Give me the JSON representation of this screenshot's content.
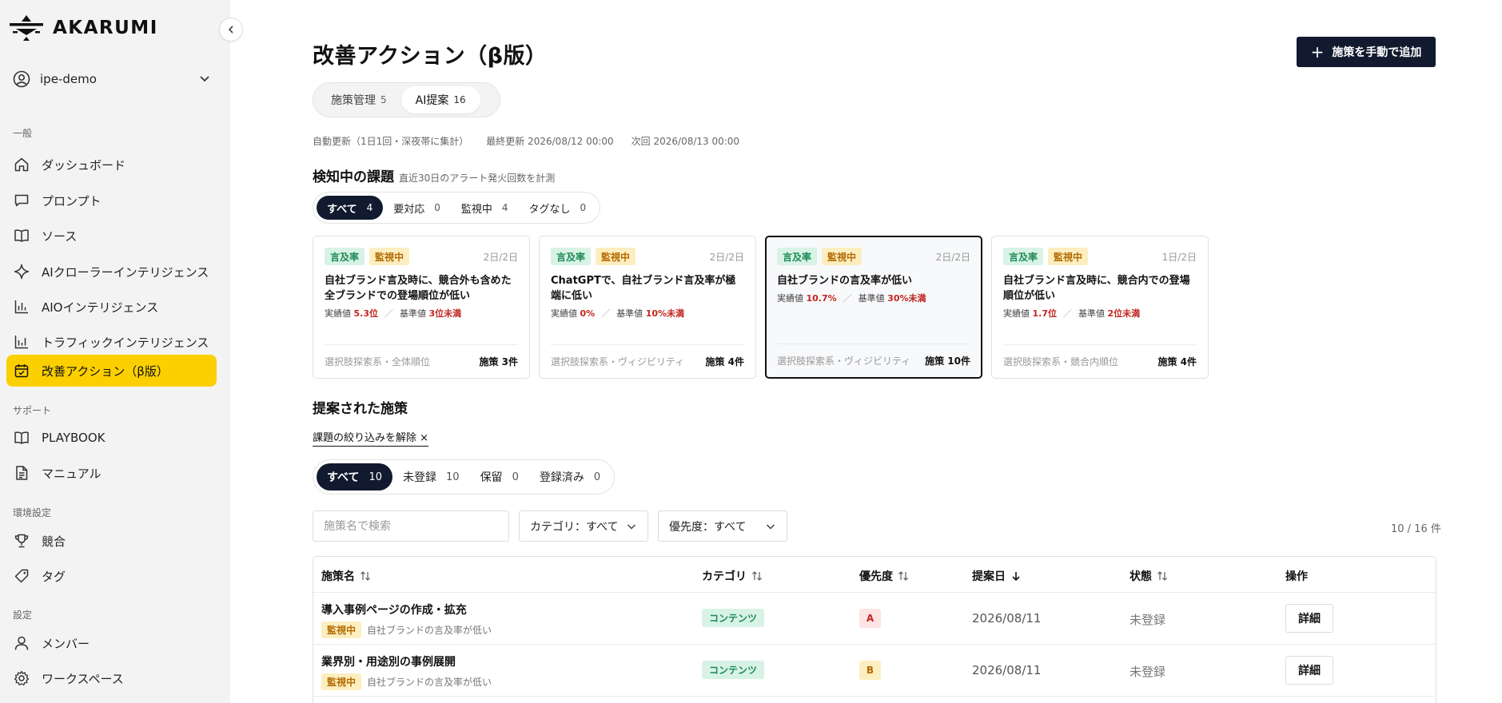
{
  "app": {
    "brand": "AKARUMI"
  },
  "sidebar": {
    "workspace": "ipe-demo",
    "sections": {
      "general": "一般",
      "support": "サポート",
      "env": "環境設定",
      "settings": "設定"
    },
    "items": {
      "dashboard": "ダッシュボード",
      "prompt": "プロンプト",
      "source": "ソース",
      "crawler": "AIクローラーインテリジェンス",
      "aio": "AIOインテリジェンス",
      "traffic": "トラフィックインテリジェンス",
      "actions": "改善アクション（β版）",
      "playbook": "PLAYBOOK",
      "manual": "マニュアル",
      "competitor": "競合",
      "tag": "タグ",
      "member": "メンバー",
      "workspace": "ワークスペース"
    }
  },
  "header": {
    "title": "改善アクション（β版）",
    "add_button": "施策を手動で追加",
    "tabs": [
      {
        "label": "施策管理",
        "count": "5"
      },
      {
        "label": "AI提案",
        "count": "16"
      }
    ],
    "auto_update": "自動更新（1日1回・深夜帯に集計）",
    "last_update": "最終更新 2026/08/12 00:00",
    "next_update": "次回 2026/08/13 00:00"
  },
  "issues": {
    "heading": "検知中の課題",
    "sub": "直近30日のアラート発火回数を計測",
    "filters": [
      {
        "label": "すべて",
        "count": "4"
      },
      {
        "label": "要対応",
        "count": "0"
      },
      {
        "label": "監視中",
        "count": "4"
      },
      {
        "label": "タグなし",
        "count": "0"
      }
    ],
    "cards": [
      {
        "tag1": "言及率",
        "tag2": "監視中",
        "days": "2日/2日",
        "title": "自社ブランド言及時に、競合外も含めた全ブランドでの登場順位が低い",
        "actual_label": "実績値",
        "actual": "5.3位",
        "base_label": "基準値",
        "base": "3位未満",
        "category": "選択肢探索系・全体順位",
        "count": "施策 3件"
      },
      {
        "tag1": "言及率",
        "tag2": "監視中",
        "days": "2日/2日",
        "title": "ChatGPTで、自社ブランド言及率が極端に低い",
        "actual_label": "実績値",
        "actual": "0%",
        "base_label": "基準値",
        "base": "10%未満",
        "category": "選択肢探索系・ヴィジビリティ",
        "count": "施策 4件"
      },
      {
        "tag1": "言及率",
        "tag2": "監視中",
        "days": "2日/2日",
        "title": "自社ブランドの言及率が低い",
        "actual_label": "実績値",
        "actual": "10.7%",
        "base_label": "基準値",
        "base": "30%未満",
        "category": "選択肢探索系・ヴィジビリティ",
        "count": "施策 10件"
      },
      {
        "tag1": "言及率",
        "tag2": "監視中",
        "days": "1日/2日",
        "title": "自社ブランド言及時に、競合内での登場順位が低い",
        "actual_label": "実績値",
        "actual": "1.7位",
        "base_label": "基準値",
        "base": "2位未満",
        "category": "選択肢探索系・競合内順位",
        "count": "施策 4件"
      }
    ]
  },
  "proposals": {
    "heading": "提案された施策",
    "clear_filter": "課題の絞り込みを解除 ×",
    "filters": [
      {
        "label": "すべて",
        "count": "10"
      },
      {
        "label": "未登録",
        "count": "10"
      },
      {
        "label": "保留",
        "count": "0"
      },
      {
        "label": "登録済み",
        "count": "0"
      }
    ],
    "search_placeholder": "施策名で検索",
    "category_select": "カテゴリ：すべて",
    "priority_select": "優先度：すべて",
    "result_count": "10 / 16 件",
    "columns": [
      "施策名",
      "カテゴリ",
      "優先度",
      "提案日",
      "状態",
      "操作"
    ],
    "rows": [
      {
        "name": "導入事例ページの作成・拡充",
        "tag": "監視中",
        "issue": "自社ブランドの言及率が低い",
        "category": "コンテンツ",
        "priority": "A",
        "date": "2026/08/11",
        "status": "未登録",
        "action": "詳細"
      },
      {
        "name": "業界別・用途別の事例展開",
        "tag": "監視中",
        "issue": "自社ブランドの言及率が低い",
        "category": "コンテンツ",
        "priority": "B",
        "date": "2026/08/11",
        "status": "未登録",
        "action": "詳細"
      }
    ]
  },
  "colors": {
    "accent": "#fcd000",
    "dark": "#111a2e",
    "green": "#1e8a57",
    "red": "#c0261f"
  }
}
